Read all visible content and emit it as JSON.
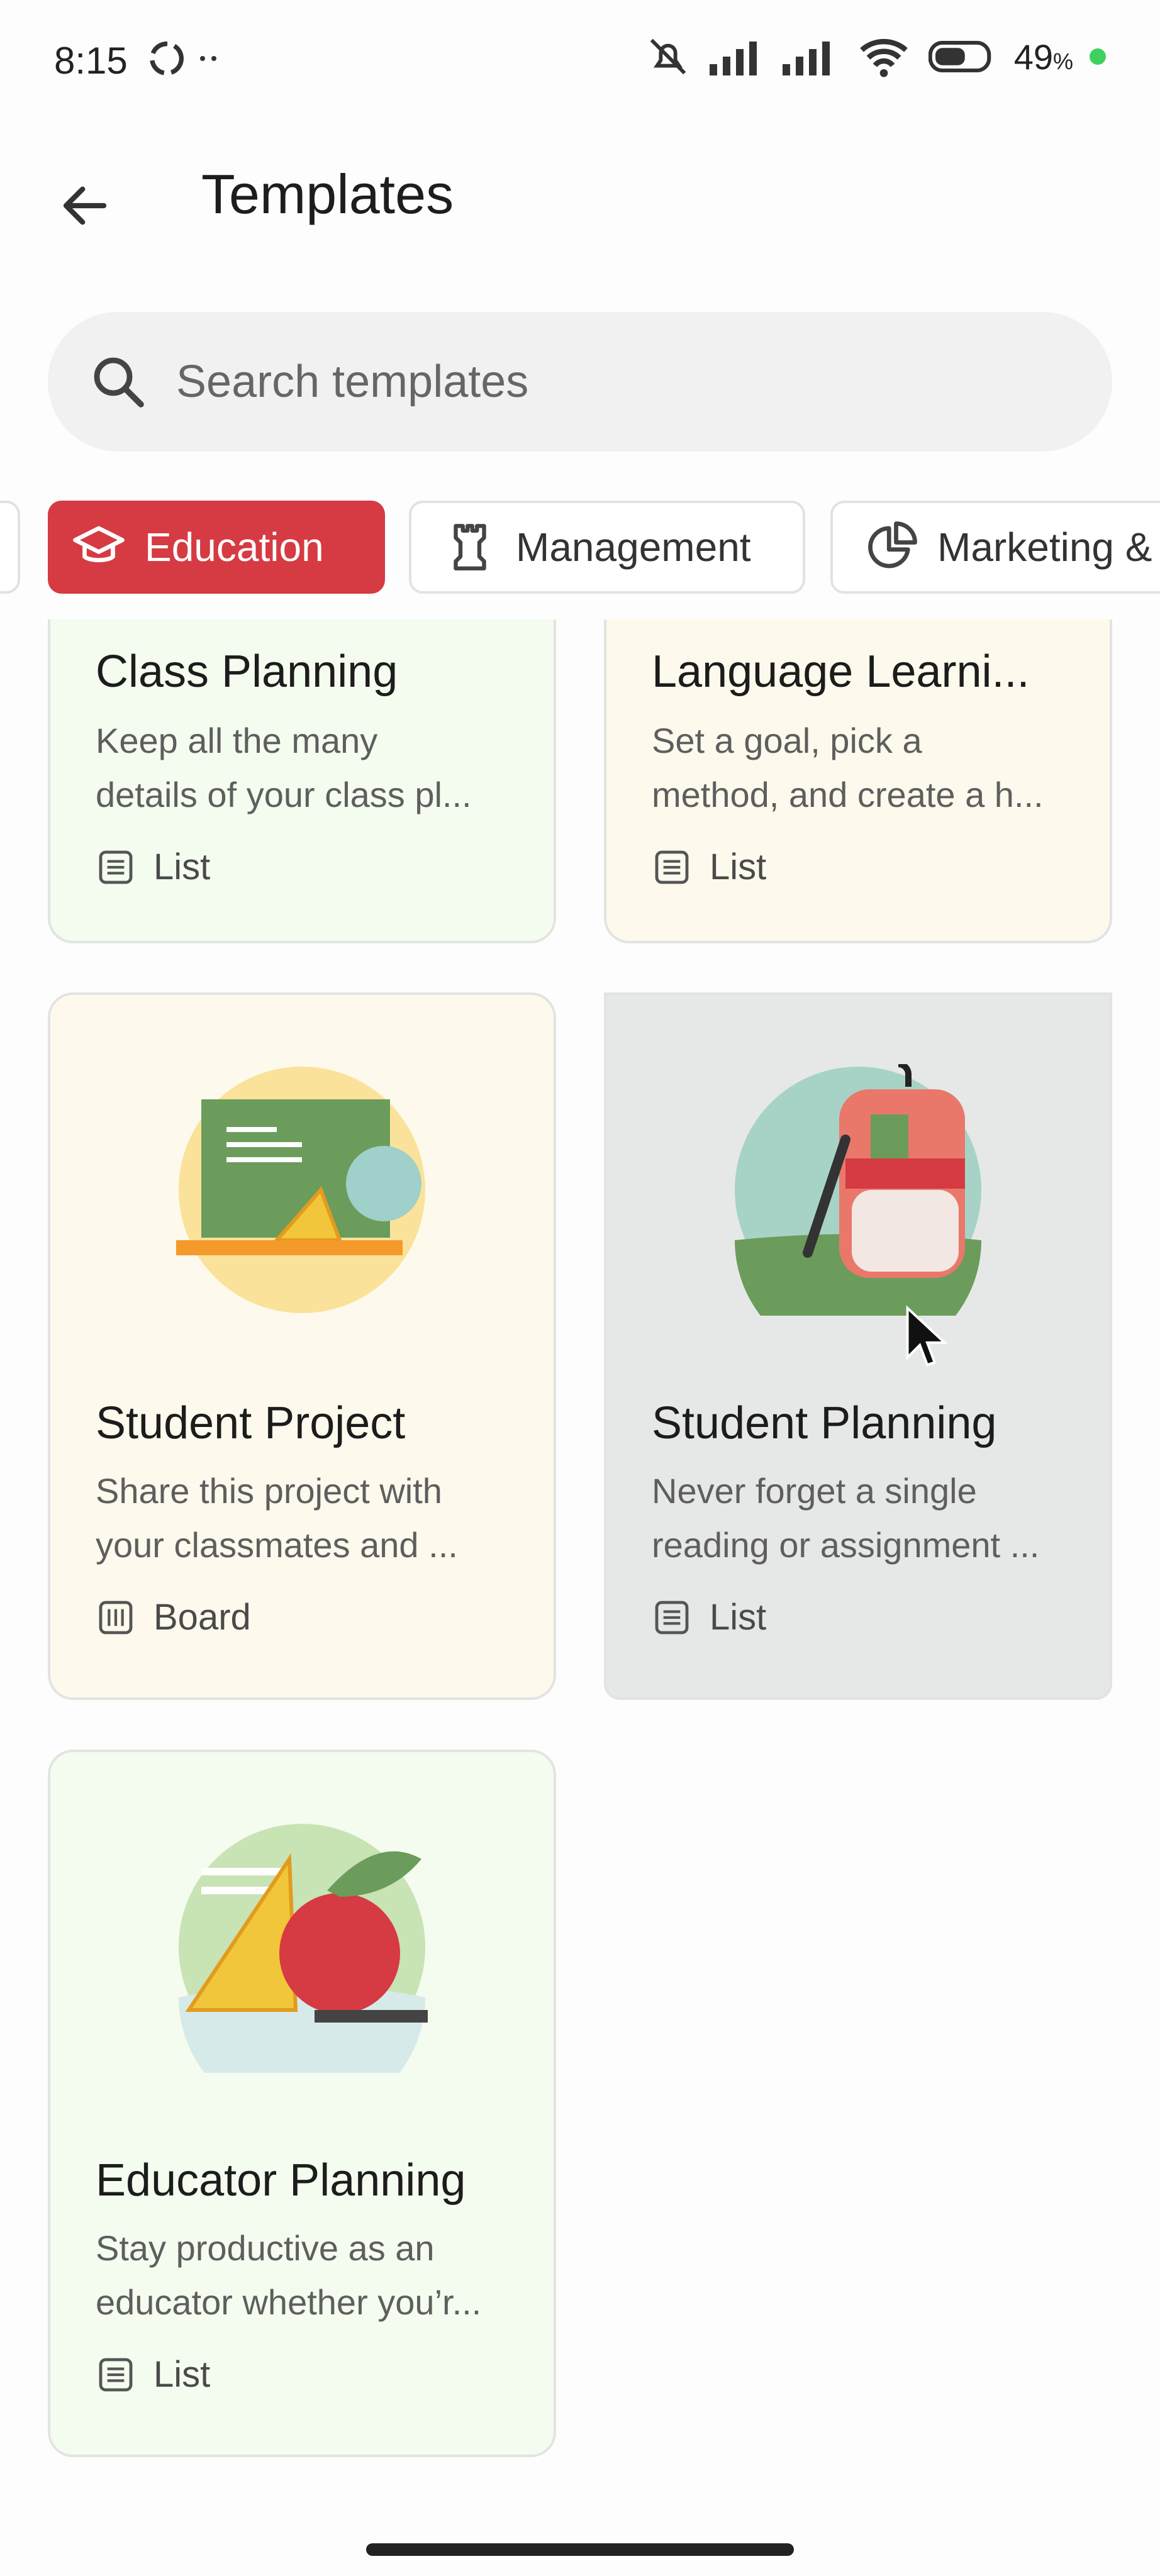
{
  "status_bar": {
    "time": "8:15",
    "battery": "49",
    "battery_unit": "%"
  },
  "header": {
    "title": "Templates"
  },
  "search": {
    "placeholder": "Search templates"
  },
  "chips": {
    "education": "Education",
    "management": "Management",
    "marketing": "Marketing &",
    "selected": "Education"
  },
  "cards": [
    {
      "title": "Class Planning",
      "desc_line1": "Keep all the many",
      "desc_line2": "details of your class pl...",
      "type": "List",
      "bg": "#f4fbef"
    },
    {
      "title": "Language Learni...",
      "desc_line1": "Set a goal, pick a",
      "desc_line2": "method, and create a h...",
      "type": "List",
      "bg": "#fdf9ec"
    },
    {
      "title": "Student Project",
      "desc_line1": "Share this project with",
      "desc_line2": "your classmates and ...",
      "type": "Board",
      "bg": "#fdf9ec"
    },
    {
      "title": "Student Planning",
      "desc_line1": "Never forget a single",
      "desc_line2": "reading or assignment ...",
      "type": "List",
      "bg": "#e6e8e8"
    },
    {
      "title": "Educator Planning",
      "desc_line1": "Stay productive as an",
      "desc_line2": "educator whether you’r...",
      "type": "List",
      "bg": "#f4fbef"
    }
  ],
  "icons": [
    "back-arrow-icon",
    "search-icon",
    "graduation-cap-icon",
    "chess-rook-icon",
    "pie-chart-icon",
    "list-icon",
    "board-icon",
    "cursor-icon"
  ],
  "colors": {
    "accent": "#d63a42",
    "status_dot": "#3fd15f"
  }
}
